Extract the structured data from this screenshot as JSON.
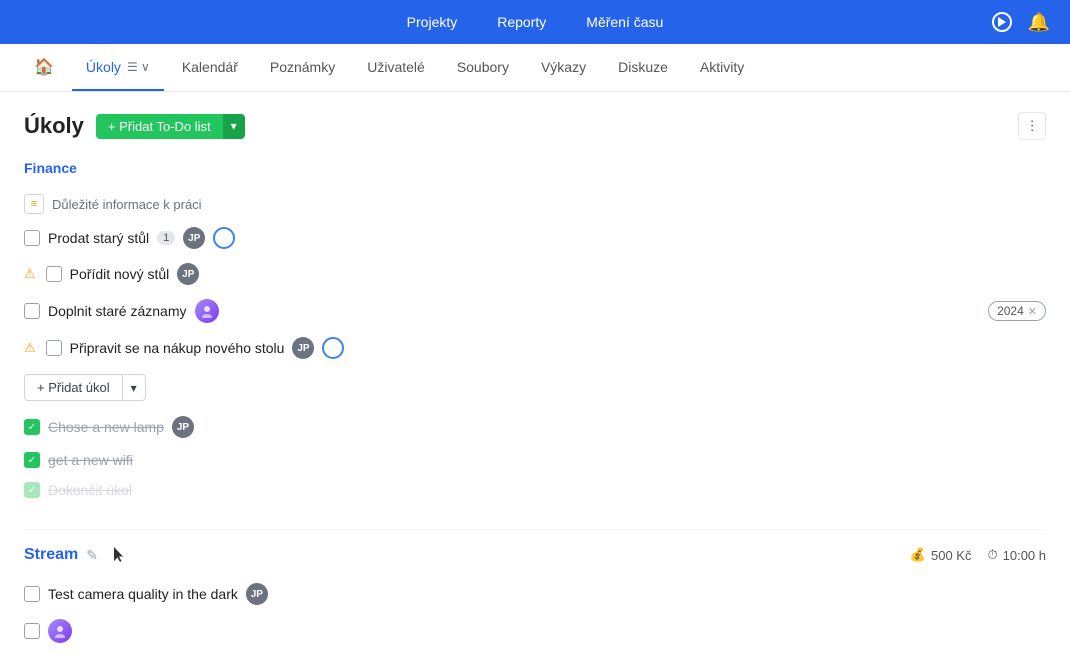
{
  "topNav": {
    "items": [
      "Projekty",
      "Reporty",
      "Měření času"
    ],
    "playLabel": "play",
    "bellLabel": "bell"
  },
  "subNav": {
    "items": [
      {
        "label": "",
        "icon": "home",
        "active": false
      },
      {
        "label": "Úkoly",
        "active": true
      },
      {
        "label": "Kalendář",
        "active": false
      },
      {
        "label": "Poznámky",
        "active": false
      },
      {
        "label": "Uživatelé",
        "active": false
      },
      {
        "label": "Soubory",
        "active": false
      },
      {
        "label": "Výkazy",
        "active": false
      },
      {
        "label": "Diskuze",
        "active": false
      },
      {
        "label": "Aktivity",
        "active": false
      }
    ]
  },
  "page": {
    "title": "Úkoly",
    "addTodoLabel": "+ Přidat To-Do list",
    "moreOptionsLabel": "⋮"
  },
  "financeSection": {
    "title": "Finance",
    "groupHeader": "Důležité informace k práci",
    "tasks": [
      {
        "text": "Prodat starý stůl",
        "checked": false,
        "warning": false,
        "count": "1",
        "avatarType": "jp",
        "avatarLabel": "JP",
        "hasBlueCircle": true,
        "tag": null
      },
      {
        "text": "Pořídit nový stůl",
        "checked": false,
        "warning": true,
        "count": null,
        "avatarType": "jp",
        "avatarLabel": "JP",
        "hasBlueCircle": false,
        "tag": null
      },
      {
        "text": "Doplnit staré záznamy",
        "checked": false,
        "warning": false,
        "count": null,
        "avatarType": "photo",
        "avatarLabel": "👤",
        "hasBlueCircle": false,
        "tag": "2024"
      },
      {
        "text": "Připravit se na nákup nového stolu",
        "checked": false,
        "warning": true,
        "count": null,
        "avatarType": "jp",
        "avatarLabel": "JP",
        "hasBlueCircle": true,
        "tag": null
      }
    ],
    "addTaskLabel": "+ Přidat úkol",
    "completedTasks": [
      {
        "text": "Chose a new lamp",
        "avatarLabel": "JP"
      },
      {
        "text": "get a new wifi",
        "avatarLabel": null
      },
      {
        "text": "Dokončit úkol",
        "avatarLabel": null
      }
    ]
  },
  "streamSection": {
    "title": "Stream",
    "editIcon": "✎",
    "budget": "500 Kč",
    "time": "10:00 h",
    "tasks": [
      {
        "text": "Test camera quality in the dark",
        "avatarLabel": "JP"
      }
    ]
  }
}
